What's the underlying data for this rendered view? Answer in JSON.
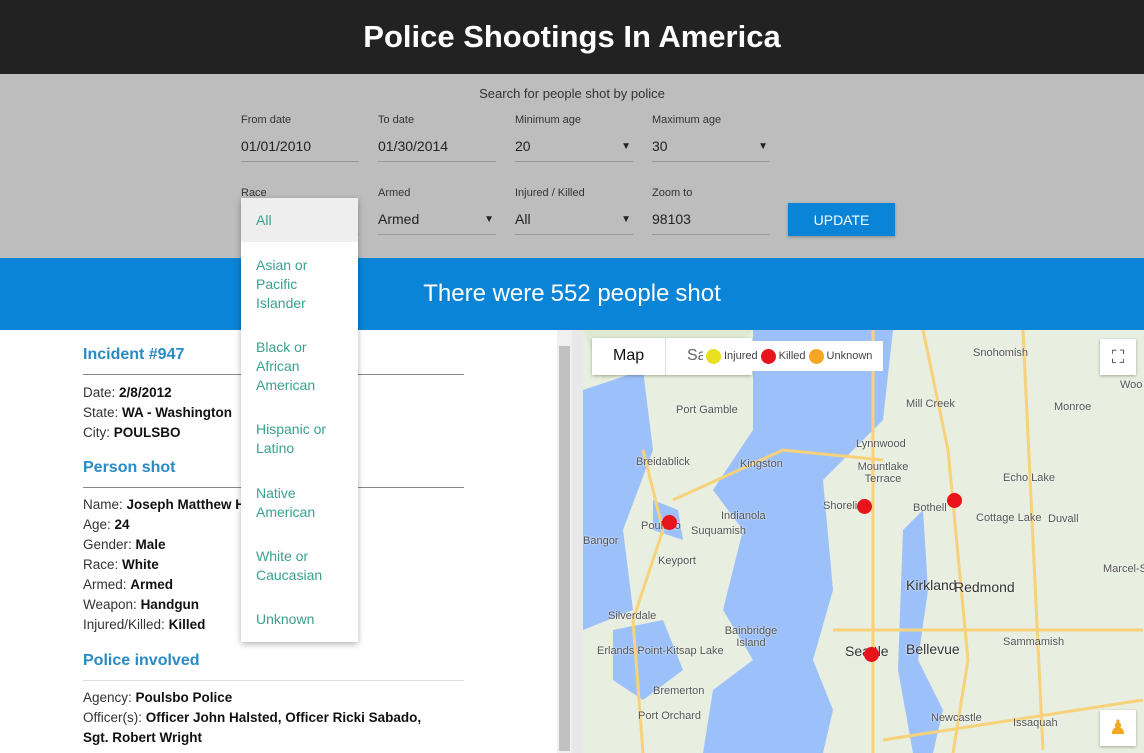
{
  "header": {
    "title": "Police Shootings In America"
  },
  "filters": {
    "subtitle": "Search for people shot by police",
    "from_date": {
      "label": "From date",
      "value": "01/01/2010"
    },
    "to_date": {
      "label": "To date",
      "value": "01/30/2014"
    },
    "min_age": {
      "label": "Minimum age",
      "value": "20"
    },
    "max_age": {
      "label": "Maximum age",
      "value": "30"
    },
    "race": {
      "label": "Race"
    },
    "armed": {
      "label": "Armed",
      "value": "Armed"
    },
    "injured_killed": {
      "label": "Injured / Killed",
      "value": "All"
    },
    "zoom_to": {
      "label": "Zoom to",
      "value": "98103"
    },
    "update_label": "UPDATE"
  },
  "race_options": [
    "All",
    "Asian or Pacific Islander",
    "Black or African American",
    "Hispanic or Latino",
    "Native American",
    "White or Caucasian",
    "Unknown"
  ],
  "banner": {
    "prefix": "There were",
    "count": "552 people",
    "suffix": "shot"
  },
  "incident": {
    "title": "Incident #947",
    "date_label": "Date:",
    "date": "2/8/2012",
    "state_label": "State:",
    "state": "WA - Washington",
    "city_label": "City:",
    "city": "POULSBO",
    "person_title": "Person shot",
    "name_label": "Name:",
    "name": "Joseph Matthew He",
    "age_label": "Age:",
    "age": "24",
    "gender_label": "Gender:",
    "gender": "Male",
    "race_label": "Race:",
    "race": "White",
    "armed_label": "Armed:",
    "armed": "Armed",
    "weapon_label": "Weapon:",
    "weapon": "Handgun",
    "ik_label": "Injured/Killed:",
    "ik": "Killed",
    "police_title": "Police involved",
    "agency_label": "Agency:",
    "agency": "Poulsbo Police",
    "officers_label": "Officer(s):",
    "officers": "Officer John Halsted, Officer Ricki Sabado, Sgt. Robert Wright"
  },
  "map": {
    "type_map": "Map",
    "type_sat": "Sa",
    "legend": [
      {
        "label": "Injured",
        "color": "#e6e01e"
      },
      {
        "label": "Killed",
        "color": "#e8141c"
      },
      {
        "label": "Unknown",
        "color": "#f5a623"
      }
    ],
    "labels": [
      "Port Gamble",
      "Breidablick",
      "Kingston",
      "Indianola",
      "Suquamish",
      "Poulsbo",
      "Bangor",
      "Keyport",
      "Silverdale",
      "Bainbridge Island",
      "Erlands Point-Kitsap Lake",
      "Bremerton",
      "Port Orchard",
      "Snohomish",
      "Mill Creek",
      "Monroe",
      "Lynnwood",
      "Mountlake Terrace",
      "Shoreline",
      "Bothell",
      "Echo Lake",
      "Cottage Lake",
      "Duvall",
      "Kirkland",
      "Redmond",
      "Seattle",
      "Bellevue",
      "Sammamish",
      "Newcastle",
      "Issaquah",
      "Woo",
      "Marcel-S"
    ]
  }
}
